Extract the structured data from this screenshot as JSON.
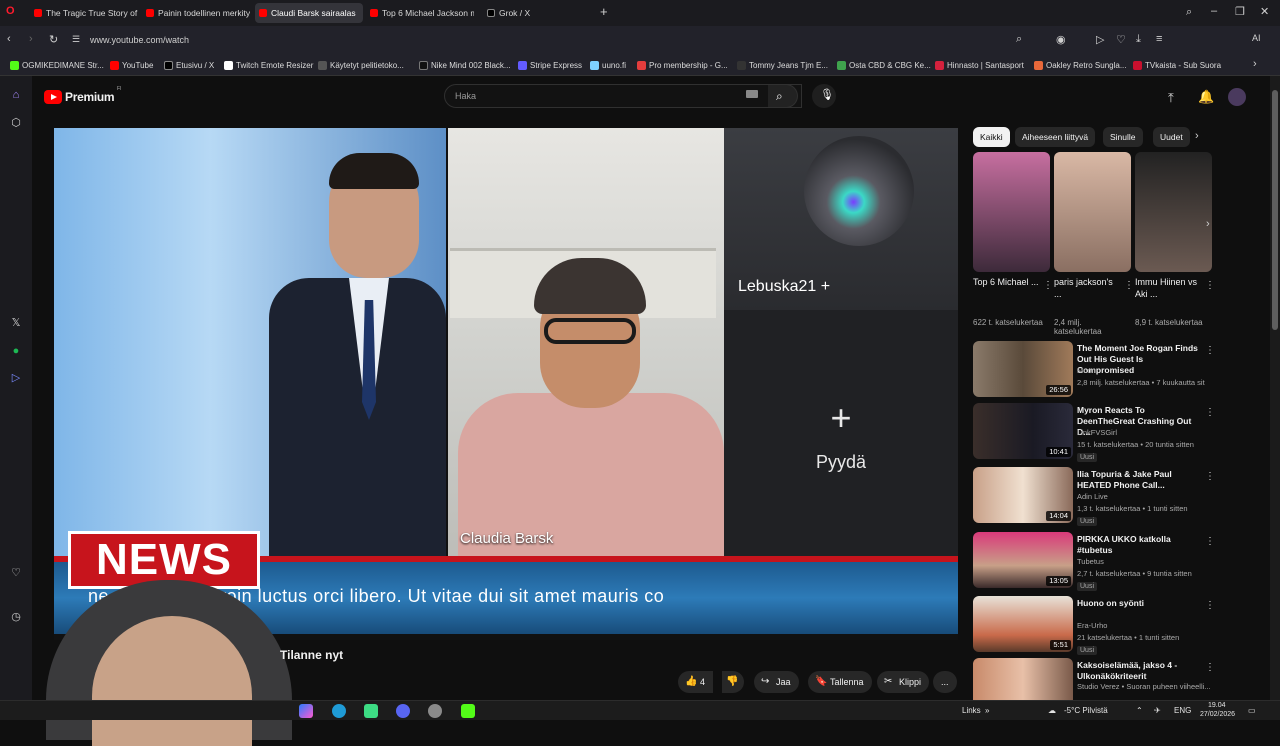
{
  "browser": {
    "tabs": [
      {
        "label": "The Tragic True Story of Ju"
      },
      {
        "label": "Painin todellinen merkity"
      },
      {
        "label": "Claudi Barsk sairaalas"
      },
      {
        "label": "Top 6 Michael Jackson m"
      },
      {
        "label": "Grok / X"
      }
    ],
    "new_tab": "+",
    "url": "www.youtube.com/watch",
    "bookmarks": [
      {
        "label": "OGMIKEDIMANE Str...",
        "color": "#53fc18"
      },
      {
        "label": "YouTube",
        "color": "#ff0000"
      },
      {
        "label": "Etusivu / X",
        "color": "#000000"
      },
      {
        "label": "Twitch Emote Resizer",
        "color": "#ffffff"
      },
      {
        "label": "Käytetyt pelitietoko...",
        "color": "#333333"
      },
      {
        "label": "Nike Mind 002 Black...",
        "color": "#111111"
      },
      {
        "label": "Stripe Express",
        "color": "#635bff"
      },
      {
        "label": "uuno.fi",
        "color": "#7fd1ff"
      },
      {
        "label": "Pro membership - G...",
        "color": "#e43d3d"
      },
      {
        "label": "Tommy Jeans Tjm E...",
        "color": "#222222"
      },
      {
        "label": "Osta CBD & CBG Ke...",
        "color": "#3fa34d"
      },
      {
        "label": "Hinnasto | Santasport",
        "color": "#d4213d"
      },
      {
        "label": "Oakley Retro Sungla...",
        "color": "#e8683a"
      },
      {
        "label": "TVkaista - Sub Suora",
        "color": "#c8102e"
      }
    ]
  },
  "youtube": {
    "logo_text": "Premium",
    "logo_sup": "FI",
    "search_placeholder": "Haka",
    "video": {
      "participant_name": "Claudia Barsk",
      "streamer_name": "Lebuska21 +",
      "empty_slot_label": "Pyydä",
      "news_label": "NEWS",
      "ticker_text": "ne... cing elit. Proin luctus orci libero. Ut vitae dui sit amet mauris co"
    },
    "title_fragment": "Tilanne nyt",
    "actions": {
      "likes": "4",
      "share": "Jaa",
      "save": "Tallenna",
      "clip": "Klippi",
      "more": "..."
    },
    "chips": [
      "Kaikki",
      "Aiheeseen liittyvä",
      "Sinulle",
      "Uudet"
    ],
    "shorts": [
      {
        "title": "Top 6 Michael ...",
        "views": "622 t. katselukertaa"
      },
      {
        "title": "paris jackson's ...",
        "views": "2,4 milj. katselukertaa"
      },
      {
        "title": "Immu Hiinen vs Aki ...",
        "views": "8,9 t. katselukertaa"
      }
    ],
    "recommended": [
      {
        "title": "The Moment Joe Rogan Finds Out His Guest Is Compromised",
        "channel": "Moon",
        "meta": "2,8 milj. katselukertaa • 7 kuukautta sit...",
        "duration": "26:56",
        "badge": ""
      },
      {
        "title": "Myron Reacts To DeenTheGreat Crashing Out D...",
        "channel": "LinkFVSGirl",
        "meta": "15 t. katselukertaa • 20 tuntia sitten",
        "duration": "10:41",
        "badge": "Uusi"
      },
      {
        "title": "Ilia Topuria & Jake Paul HEATED Phone Call...",
        "channel": "Adin Live",
        "meta": "1,3 t. katselukertaa • 1 tunti sitten",
        "duration": "14:04",
        "badge": "Uusi"
      },
      {
        "title": "PIRKKA UKKO katkolla #tubetus",
        "channel": "Tubetus",
        "meta": "2,7 t. katselukertaa • 9 tuntia sitten",
        "duration": "13:05",
        "badge": "Uusi"
      },
      {
        "title": "Huono on syönti",
        "channel": "Era-Urho",
        "meta": "21 katselukertaa • 1 tunti sitten",
        "duration": "5:51",
        "badge": "Uusi"
      },
      {
        "title": "Kaksoiselämää, jakso 4 - Ulkonäkökriteerit",
        "channel": "Studio Verez",
        "meta": "Suoran puheen viiheelli...",
        "duration": "",
        "badge": ""
      }
    ]
  },
  "taskbar": {
    "links": "Links",
    "weather": "-5°C Pilvistä",
    "lang": "ENG",
    "time": "19.04",
    "date": "27/02/2026"
  },
  "colors": {
    "accent_red": "#ff0000",
    "news_red": "#c7141c",
    "ticker_blue": "#2d7bb8"
  }
}
